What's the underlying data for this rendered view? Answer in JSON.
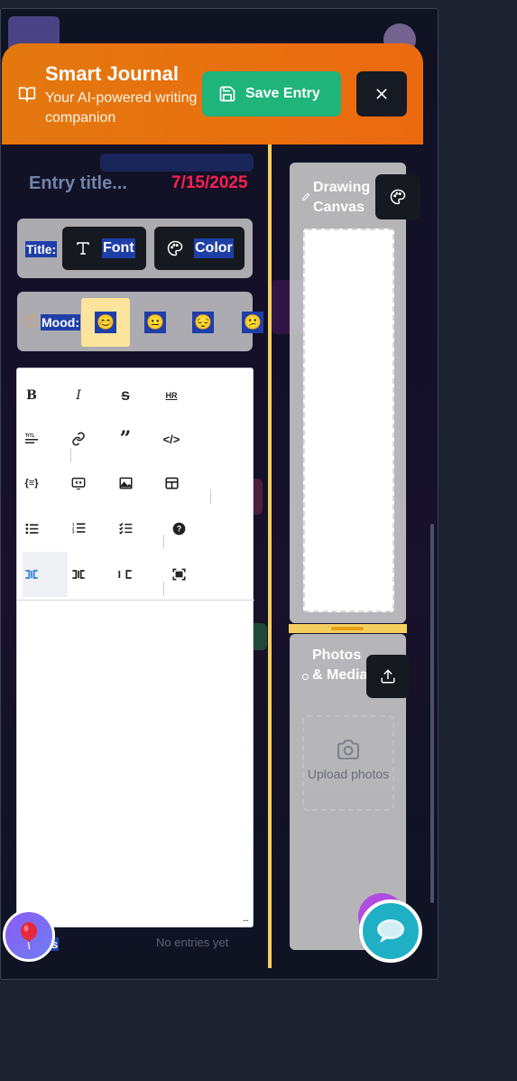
{
  "header": {
    "title": "Smart Journal",
    "subtitle": "Your AI-powered writing companion",
    "save_label": "Save Entry",
    "close_label": "×"
  },
  "entry": {
    "title_placeholder": "Entry title...",
    "date": "7/15/2025"
  },
  "title_style": {
    "label": "Title:",
    "font_label": "Font",
    "color_label": "Color"
  },
  "mood": {
    "label": "Mood:",
    "options": [
      "😊",
      "😐",
      "😔",
      "😕"
    ],
    "selected_index": 0
  },
  "editor": {
    "toolbar": [
      [
        "B",
        "I",
        "S",
        "HR"
      ],
      [
        "title-icon",
        "link-icon",
        "quote-icon",
        "code-icon"
      ],
      [
        "variable-icon",
        "preview-icon",
        "image-icon",
        "table-icon"
      ],
      [
        "unordered-list-icon",
        "ordered-list-icon",
        "checklist-icon",
        "help-icon"
      ],
      [
        "edit-mode-icon",
        "split-mode-icon",
        "preview-mode-icon",
        "fullscreen-icon"
      ]
    ],
    "resize_handle": "..."
  },
  "drawing": {
    "title": "Drawing Canvas"
  },
  "photos": {
    "title": "Photos & Media",
    "upload_text": "Upload photos"
  },
  "background": {
    "partial_selection": "s",
    "faint_text": "No entries yet"
  },
  "colors": {
    "header_orange": "#e3780f",
    "save_green": "#1fb47a",
    "date_red": "#ff1f52",
    "divider_yellow": "#f4cf5e",
    "selection_blue": "#1f3fa8",
    "chat_teal": "#1fb0c5"
  }
}
